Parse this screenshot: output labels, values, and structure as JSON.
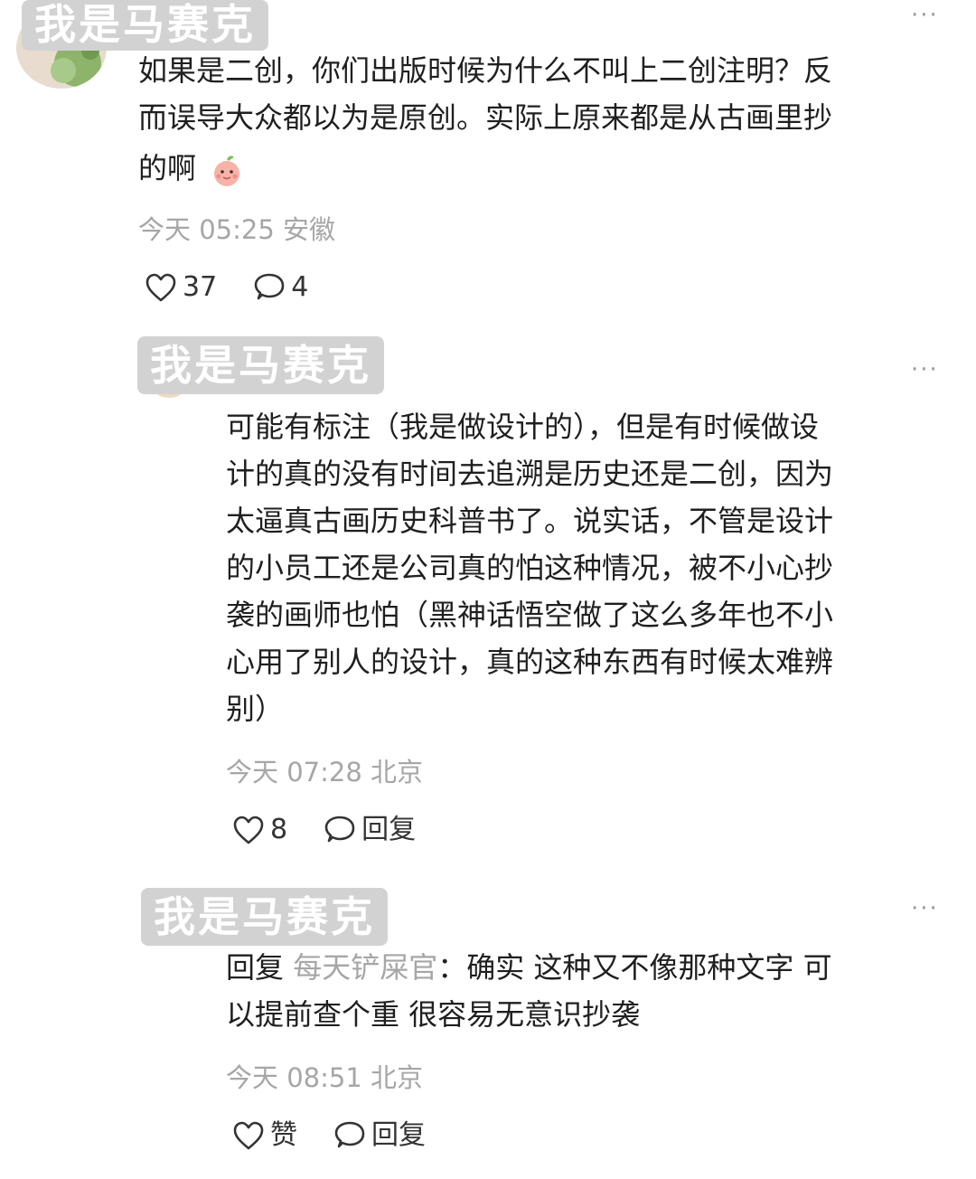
{
  "comments": [
    {
      "username": "我是马赛克",
      "lines": [
        "如果是二创，你们出版时候为什么不叫上二创注明？反",
        "而误导大众都以为是原创。实际上原来都是从古画里抄",
        "的啊"
      ],
      "meta": "今天 05:25 安徽",
      "likes": "37",
      "replies": "4"
    },
    {
      "username": "我是马赛克",
      "lines": [
        "可能有标注（我是做设计的），但是有时候做设",
        "计的真的没有时间去追溯是历史还是二创，因为",
        "太逼真古画历史科普书了。说实话，不管是设计",
        "的小员工还是公司真的怕这种情况，被不小心抄",
        "袭的画师也怕（黑神话悟空做了这么多年也不小",
        "心用了别人的设计，真的这种东西有时候太难辨",
        "别）"
      ],
      "meta": "今天 07:28 北京",
      "likes": "8",
      "reply_label": "回复"
    },
    {
      "username": "我是马赛克",
      "reply_prefix": "回复",
      "reply_to": "每天铲屎官",
      "reply_sep": "：",
      "line1_rest": "确实 这种又不像那种文字 可",
      "line2": "以提前查个重 很容易无意识抄袭",
      "meta": "今天 08:51 北京",
      "likes": "赞",
      "reply_label": "回复"
    }
  ],
  "more_label": "···"
}
